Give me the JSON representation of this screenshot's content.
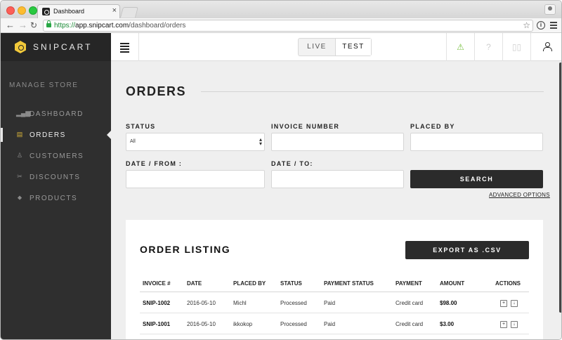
{
  "browser": {
    "tab_title": "Dashboard",
    "tab_close": "×",
    "url_scheme": "https://",
    "url_host": "app.snipcart.com",
    "url_path": "/dashboard/orders"
  },
  "brand": {
    "name": "SNIPCART",
    "color": "#f2c93a"
  },
  "sidebar": {
    "section_title": "MANAGE STORE",
    "items": [
      {
        "label": "DASHBOARD",
        "icon": "bar-chart-icon",
        "glyph": "▂▄▆",
        "active": false
      },
      {
        "label": "ORDERS",
        "icon": "orders-icon",
        "glyph": "▤",
        "active": true
      },
      {
        "label": "CUSTOMERS",
        "icon": "customers-icon",
        "glyph": "♙",
        "active": false
      },
      {
        "label": "DISCOUNTS",
        "icon": "scissors-icon",
        "glyph": "✂",
        "active": false
      },
      {
        "label": "PRODUCTS",
        "icon": "tag-icon",
        "glyph": "⬥",
        "active": false
      }
    ]
  },
  "topbar": {
    "env_live": "LIVE",
    "env_test": "TEST",
    "warning_glyph": "⚠",
    "help_glyph": "?",
    "docs_glyph": "📖"
  },
  "orders": {
    "title": "ORDERS",
    "filters": {
      "status_label": "STATUS",
      "status_value": "All",
      "invoice_label": "INVOICE NUMBER",
      "placed_by_label": "PLACED BY",
      "date_from_label": "DATE / FROM :",
      "date_to_label": "DATE / TO:",
      "search_button": "SEARCH",
      "advanced_options": "ADVANCED OPTIONS"
    },
    "listing": {
      "title": "ORDER LISTING",
      "export_button": "EXPORT AS .CSV",
      "columns": [
        "INVOICE #",
        "DATE",
        "PLACED BY",
        "STATUS",
        "PAYMENT STATUS",
        "PAYMENT",
        "AMOUNT",
        "ACTIONS"
      ],
      "rows": [
        {
          "invoice": "SNIP-1002",
          "date": "2016-05-10",
          "placed_by": "Michl",
          "status": "Processed",
          "payment_status": "Paid",
          "payment": "Credit card",
          "amount": "$98.00"
        },
        {
          "invoice": "SNIP-1001",
          "date": "2016-05-10",
          "placed_by": "ikkokop",
          "status": "Processed",
          "payment_status": "Paid",
          "payment": "Credit card",
          "amount": "$3.00"
        }
      ]
    }
  }
}
